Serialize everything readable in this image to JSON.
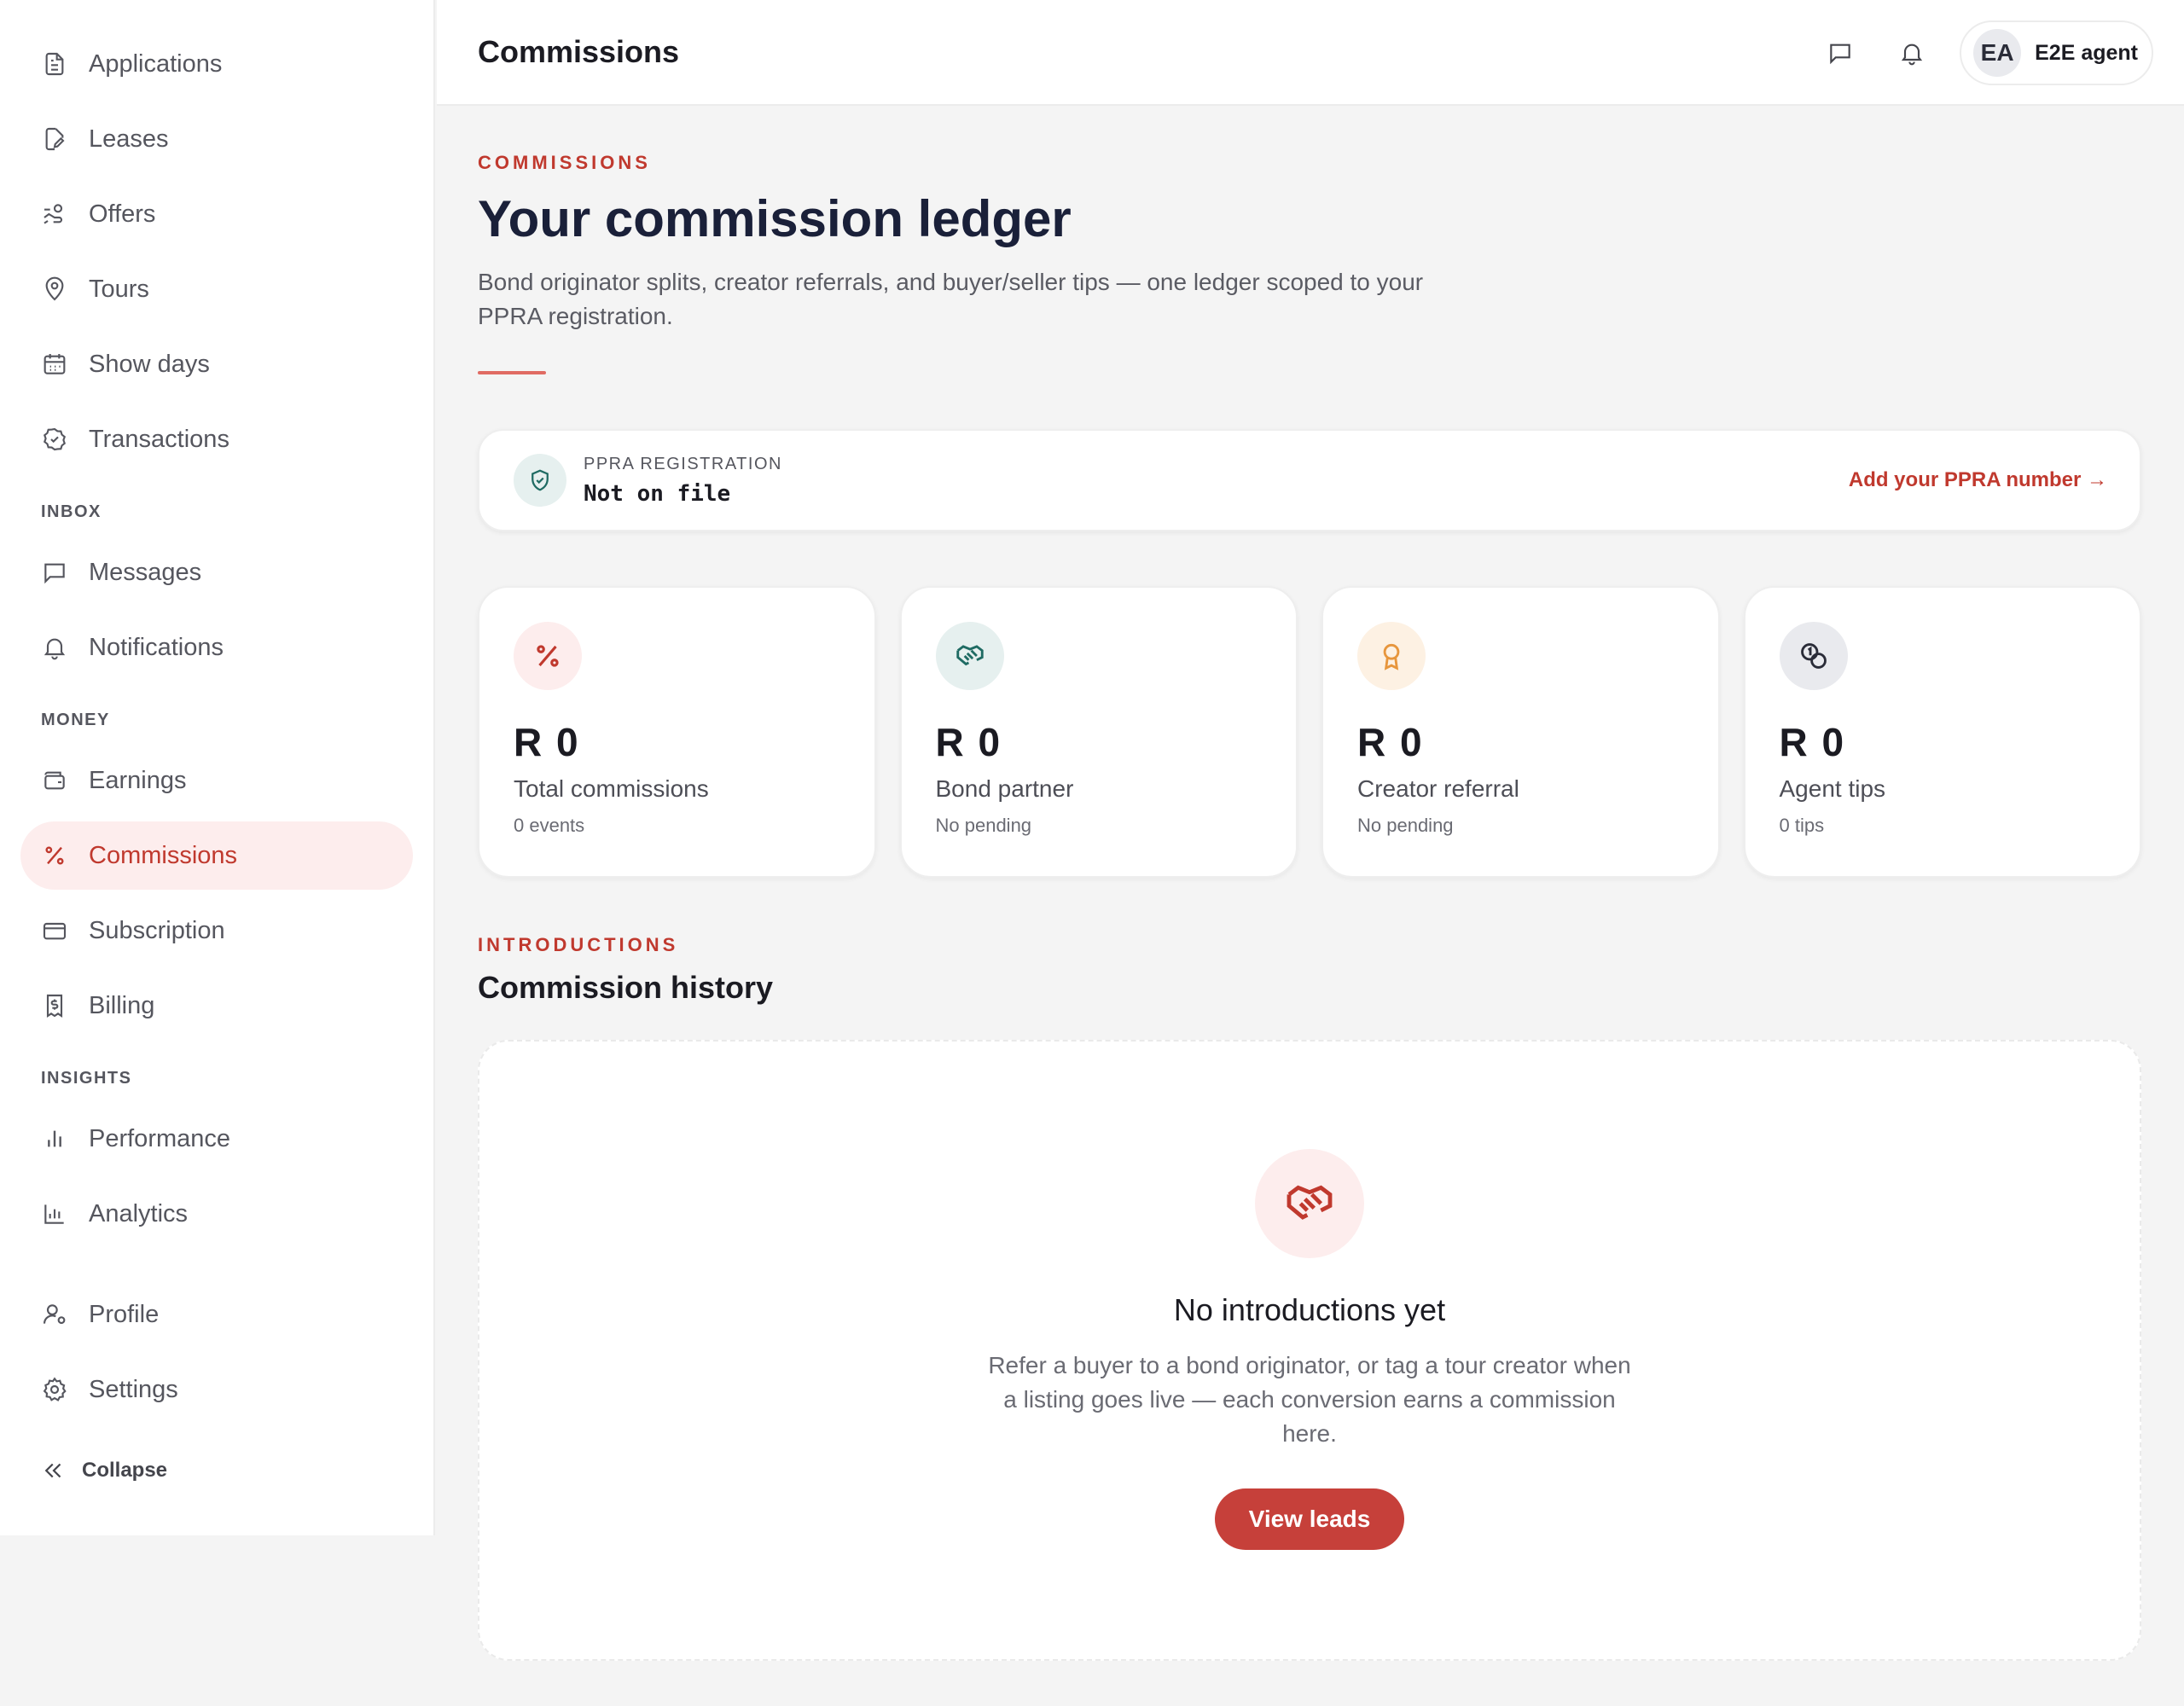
{
  "sidebar": {
    "items_top": [
      {
        "label": "Applications",
        "icon": "document-icon"
      },
      {
        "label": "Leases",
        "icon": "edit-document-icon"
      },
      {
        "label": "Offers",
        "icon": "hand-offer-icon"
      },
      {
        "label": "Tours",
        "icon": "map-pin-icon"
      },
      {
        "label": "Show days",
        "icon": "calendar-icon"
      },
      {
        "label": "Transactions",
        "icon": "check-badge-icon"
      }
    ],
    "section_inbox": "INBOX",
    "items_inbox": [
      {
        "label": "Messages",
        "icon": "chat-icon"
      },
      {
        "label": "Notifications",
        "icon": "bell-icon"
      }
    ],
    "section_money": "MONEY",
    "items_money": [
      {
        "label": "Earnings",
        "icon": "wallet-icon"
      },
      {
        "label": "Commissions",
        "icon": "percent-icon"
      },
      {
        "label": "Subscription",
        "icon": "credit-card-icon"
      },
      {
        "label": "Billing",
        "icon": "receipt-icon"
      }
    ],
    "section_insights": "INSIGHTS",
    "items_insights": [
      {
        "label": "Performance",
        "icon": "bar-chart-icon"
      },
      {
        "label": "Analytics",
        "icon": "analytics-icon"
      }
    ],
    "items_bottom": [
      {
        "label": "Profile",
        "icon": "user-settings-icon"
      },
      {
        "label": "Settings",
        "icon": "gear-icon"
      }
    ],
    "collapse_label": "Collapse",
    "active_item": "Commissions"
  },
  "topbar": {
    "title": "Commissions",
    "user_initials": "EA",
    "user_name": "E2E agent"
  },
  "main": {
    "eyebrow": "COMMISSIONS",
    "heading": "Your commission ledger",
    "lead": "Bond originator splits, creator referrals, and buyer/seller tips — one ledger scoped to your PPRA registration.",
    "ppra": {
      "label": "PPRA REGISTRATION",
      "value": "Not on file",
      "link": "Add your PPRA number →"
    },
    "stats": [
      {
        "value": "R 0",
        "label": "Total commissions",
        "sub": "0 events",
        "icon": "percent-icon",
        "bg": "#fdeded",
        "fg": "#c0392e"
      },
      {
        "value": "R 0",
        "label": "Bond partner",
        "sub": "No pending",
        "icon": "handshake-icon",
        "bg": "#e6f0ef",
        "fg": "#1f6b63"
      },
      {
        "value": "R 0",
        "label": "Creator referral",
        "sub": "No pending",
        "icon": "award-icon",
        "bg": "#fdf1e3",
        "fg": "#e7963d"
      },
      {
        "value": "R 0",
        "label": "Agent tips",
        "sub": "0 tips",
        "icon": "coins-icon",
        "bg": "#e9eaee",
        "fg": "#2a2c38"
      }
    ],
    "history_eyebrow": "INTRODUCTIONS",
    "history_title": "Commission history",
    "empty": {
      "title": "No introductions yet",
      "text": "Refer a buyer to a bond originator, or tag a tour creator when a listing goes live — each conversion earns a commission here.",
      "button": "View leads",
      "icon": "handshake-icon"
    }
  },
  "colors": {
    "accent": "#c0392e",
    "active_bg": "#fdeded",
    "heading": "#1a2039"
  }
}
